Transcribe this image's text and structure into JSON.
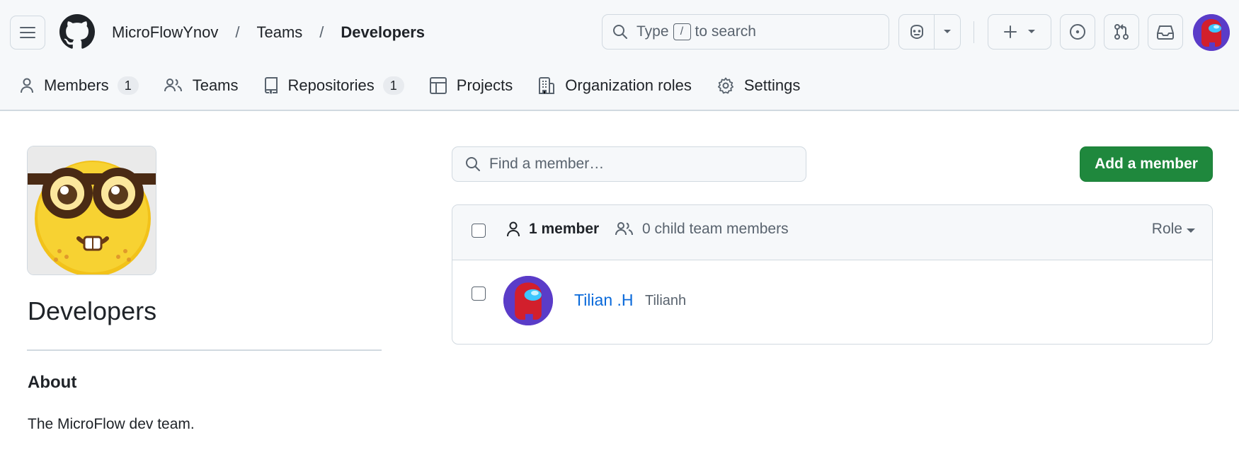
{
  "header": {
    "breadcrumb": [
      {
        "label": "MicroFlowYnov"
      },
      {
        "label": "Teams"
      },
      {
        "label": "Developers"
      }
    ],
    "separator": "/",
    "search": {
      "before": "Type",
      "key": "/",
      "after": "to search"
    }
  },
  "tabs": [
    {
      "label": "Members",
      "count": "1",
      "icon": "person-icon"
    },
    {
      "label": "Teams",
      "icon": "people-icon"
    },
    {
      "label": "Repositories",
      "count": "1",
      "icon": "repo-icon"
    },
    {
      "label": "Projects",
      "icon": "table-icon"
    },
    {
      "label": "Organization roles",
      "icon": "organization-icon"
    },
    {
      "label": "Settings",
      "icon": "gear-icon"
    }
  ],
  "team": {
    "name": "Developers",
    "about_heading": "About",
    "about_text": "The MicroFlow dev team."
  },
  "members": {
    "search_placeholder": "Find a member…",
    "add_button": "Add a member",
    "count_label": "1 member",
    "child_label": "0 child team members",
    "role_label": "Role",
    "list": [
      {
        "name": "Tilian .H",
        "login": "Tilianh"
      }
    ]
  },
  "colors": {
    "primary_button": "#1f883d",
    "link": "#0969da",
    "header_bg": "#f6f8fa"
  }
}
